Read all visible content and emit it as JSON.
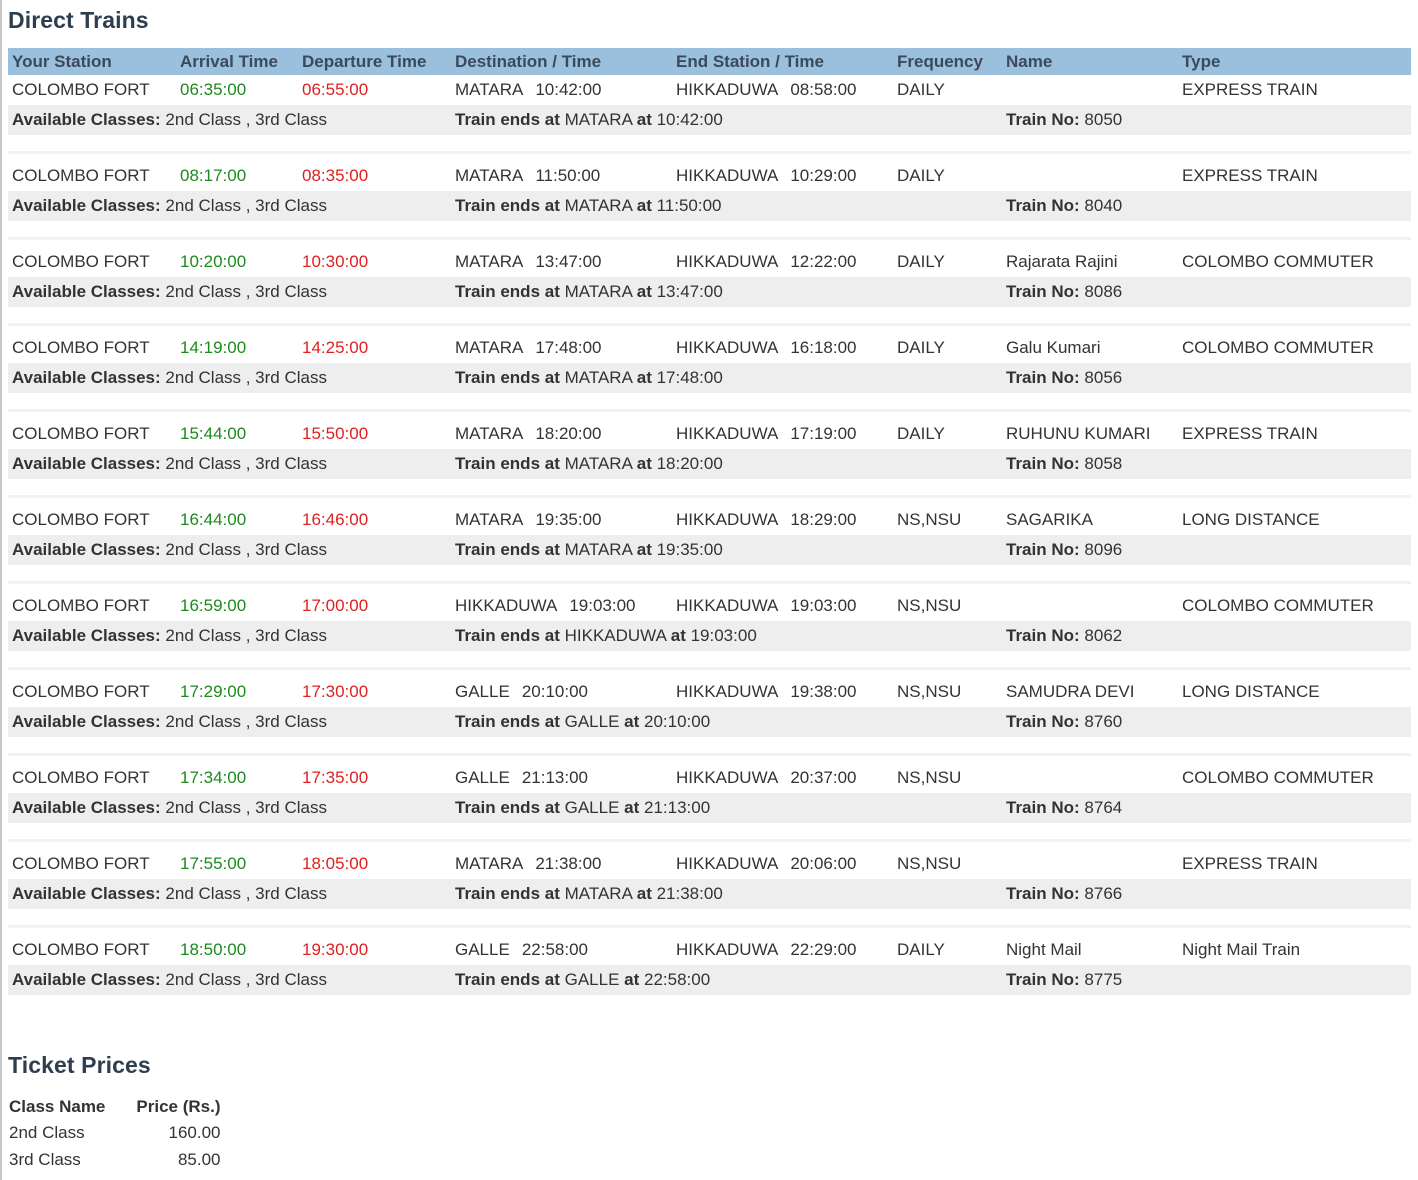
{
  "page": {
    "direct_trains_title": "Direct Trains",
    "ticket_prices_title": "Ticket Prices"
  },
  "colors": {
    "header_bg": "#9bc0dd",
    "arrival_text": "#1e8a1e",
    "departure_text": "#e02020",
    "class_row_bg": "#eeeeee",
    "title_text": "#2c3e50"
  },
  "table": {
    "columns": [
      "Your Station",
      "Arrival Time",
      "Departure Time",
      "Destination / Time",
      "End Station / Time",
      "Frequency",
      "Name",
      "Type"
    ],
    "available_classes_label": "Available Classes:",
    "train_ends_label": "Train ends at",
    "at_label": "at",
    "train_no_label": "Train No:",
    "rows": [
      {
        "station": "COLOMBO FORT",
        "arrival": "06:35:00",
        "departure": "06:55:00",
        "dest": "MATARA",
        "dest_time": "10:42:00",
        "end": "HIKKADUWA",
        "end_time": "08:58:00",
        "frequency": "DAILY",
        "name": "",
        "type": "EXPRESS TRAIN",
        "classes": "2nd Class ,  3rd Class",
        "train_no": "8050"
      },
      {
        "station": "COLOMBO FORT",
        "arrival": "08:17:00",
        "departure": "08:35:00",
        "dest": "MATARA",
        "dest_time": "11:50:00",
        "end": "HIKKADUWA",
        "end_time": "10:29:00",
        "frequency": "DAILY",
        "name": "",
        "type": "EXPRESS TRAIN",
        "classes": "2nd Class ,  3rd Class",
        "train_no": "8040"
      },
      {
        "station": "COLOMBO FORT",
        "arrival": "10:20:00",
        "departure": "10:30:00",
        "dest": "MATARA",
        "dest_time": "13:47:00",
        "end": "HIKKADUWA",
        "end_time": "12:22:00",
        "frequency": "DAILY",
        "name": "Rajarata Rajini",
        "type": "COLOMBO COMMUTER",
        "classes": "2nd Class ,  3rd Class",
        "train_no": "8086"
      },
      {
        "station": "COLOMBO FORT",
        "arrival": "14:19:00",
        "departure": "14:25:00",
        "dest": "MATARA",
        "dest_time": "17:48:00",
        "end": "HIKKADUWA",
        "end_time": "16:18:00",
        "frequency": "DAILY",
        "name": "Galu Kumari",
        "type": "COLOMBO COMMUTER",
        "classes": "2nd Class ,  3rd Class",
        "train_no": "8056"
      },
      {
        "station": "COLOMBO FORT",
        "arrival": "15:44:00",
        "departure": "15:50:00",
        "dest": "MATARA",
        "dest_time": "18:20:00",
        "end": "HIKKADUWA",
        "end_time": "17:19:00",
        "frequency": "DAILY",
        "name": "RUHUNU KUMARI",
        "type": "EXPRESS TRAIN",
        "classes": "2nd Class ,  3rd Class",
        "train_no": "8058"
      },
      {
        "station": "COLOMBO FORT",
        "arrival": "16:44:00",
        "departure": "16:46:00",
        "dest": "MATARA",
        "dest_time": "19:35:00",
        "end": "HIKKADUWA",
        "end_time": "18:29:00",
        "frequency": "NS,NSU",
        "name": "SAGARIKA",
        "type": "LONG DISTANCE",
        "classes": "2nd Class ,  3rd Class",
        "train_no": "8096"
      },
      {
        "station": "COLOMBO FORT",
        "arrival": "16:59:00",
        "departure": "17:00:00",
        "dest": "HIKKADUWA",
        "dest_time": "19:03:00",
        "end": "HIKKADUWA",
        "end_time": "19:03:00",
        "frequency": "NS,NSU",
        "name": "",
        "type": "COLOMBO COMMUTER",
        "classes": "2nd Class ,  3rd Class",
        "train_no": "8062"
      },
      {
        "station": "COLOMBO FORT",
        "arrival": "17:29:00",
        "departure": "17:30:00",
        "dest": "GALLE",
        "dest_time": "20:10:00",
        "end": "HIKKADUWA",
        "end_time": "19:38:00",
        "frequency": "NS,NSU",
        "name": "SAMUDRA DEVI",
        "type": "LONG DISTANCE",
        "classes": "2nd Class ,  3rd Class",
        "train_no": "8760"
      },
      {
        "station": "COLOMBO FORT",
        "arrival": "17:34:00",
        "departure": "17:35:00",
        "dest": "GALLE",
        "dest_time": "21:13:00",
        "end": "HIKKADUWA",
        "end_time": "20:37:00",
        "frequency": "NS,NSU",
        "name": "",
        "type": "COLOMBO COMMUTER",
        "classes": "2nd Class ,  3rd Class",
        "train_no": "8764"
      },
      {
        "station": "COLOMBO FORT",
        "arrival": "17:55:00",
        "departure": "18:05:00",
        "dest": "MATARA",
        "dest_time": "21:38:00",
        "end": "HIKKADUWA",
        "end_time": "20:06:00",
        "frequency": "NS,NSU",
        "name": "",
        "type": "EXPRESS TRAIN",
        "classes": "2nd Class ,  3rd Class",
        "train_no": "8766"
      },
      {
        "station": "COLOMBO FORT",
        "arrival": "18:50:00",
        "departure": "19:30:00",
        "dest": "GALLE",
        "dest_time": "22:58:00",
        "end": "HIKKADUWA",
        "end_time": "22:29:00",
        "frequency": "DAILY",
        "name": "Night Mail",
        "type": "Night Mail Train",
        "classes": "2nd Class ,  3rd Class",
        "train_no": "8775"
      }
    ]
  },
  "prices": {
    "columns": [
      "Class Name",
      "Price (Rs.)"
    ],
    "rows": [
      {
        "class": "2nd Class",
        "price": "160.00"
      },
      {
        "class": "3rd Class",
        "price": "85.00"
      }
    ]
  }
}
